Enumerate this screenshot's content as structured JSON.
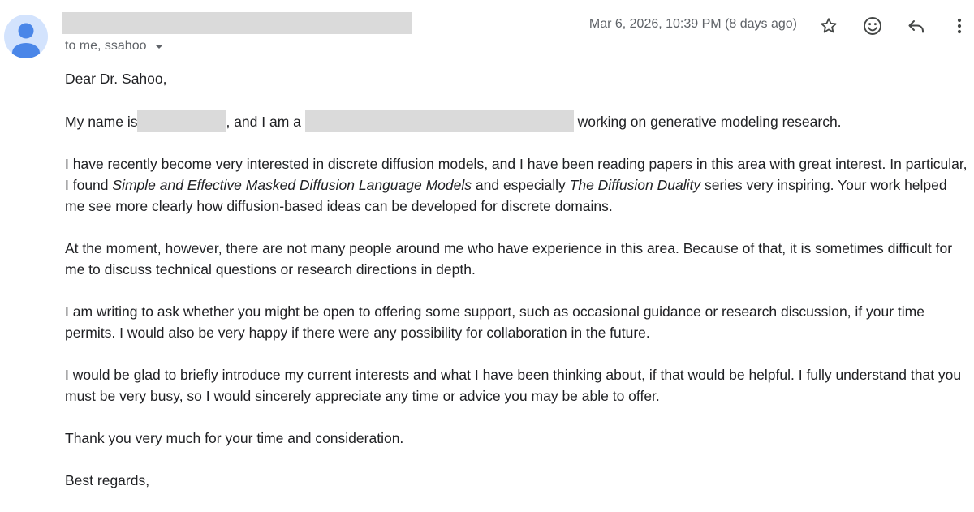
{
  "header": {
    "recipients": "to me, ssahoo",
    "date": "Mar 6, 2026, 10:39 PM (8 days ago)",
    "icons": {
      "star": "star-icon",
      "emoji": "emoji-icon",
      "reply": "reply-icon",
      "more": "more-vert-icon"
    },
    "avatar_color": "#d3e3fd",
    "avatar_figure_color": "#4a86e8"
  },
  "body": {
    "greeting": "Dear Dr. Sahoo,",
    "intro": {
      "part1": "My name is",
      "part2": ", and I am a",
      "part3": "working on generative modeling research."
    },
    "p1": {
      "part1": "I have recently become very interested in discrete diffusion models, and I have been reading papers in this area with great interest. In particular, I found ",
      "title1": "Simple and Effective Masked Diffusion Language Models",
      "part2": " and especially ",
      "title2": "The Diffusion Duality",
      "part3": " series very inspiring. Your work helped me see more clearly how diffusion-based ideas can be developed for discrete domains."
    },
    "p2": "At the moment, however, there are not many people around me who have experience in this area. Because of that, it is sometimes difficult for me to discuss technical questions or research directions in depth.",
    "p3": "I am writing to ask whether you might be open to offering some support, such as occasional guidance or research discussion, if your time permits. I would also be very happy if there were any possibility for collaboration in the future.",
    "p4": "I would be glad to briefly introduce my current interests and what I have been thinking about, if that would be helpful. I fully understand that you must be very busy, so I would sincerely appreciate any time or advice you may be able to offer.",
    "p5": "Thank you very much for your time and consideration.",
    "closing": "Best regards,"
  }
}
